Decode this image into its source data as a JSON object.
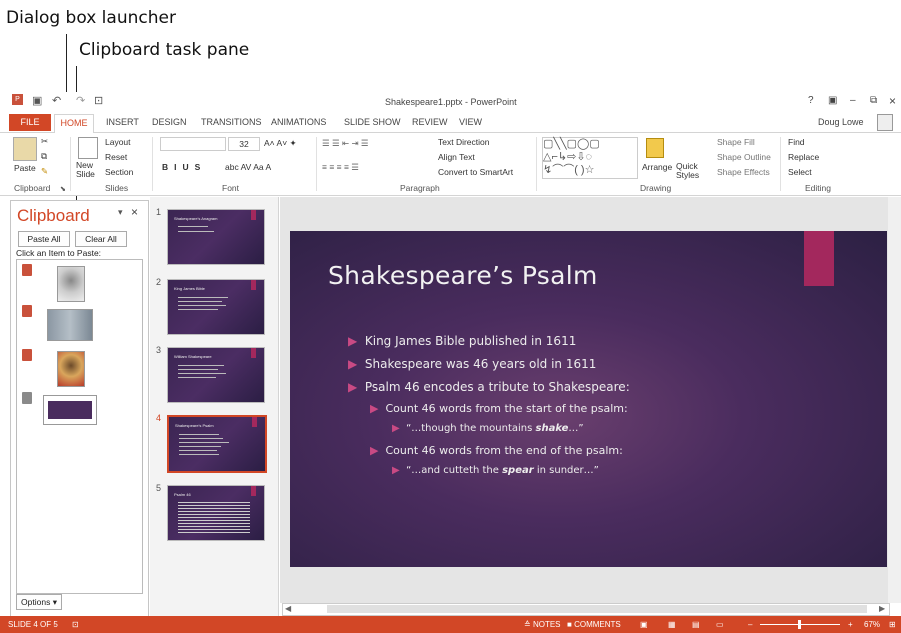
{
  "callouts": {
    "dialog_launcher": "Dialog box launcher",
    "clipboard_pane": "Clipboard task pane"
  },
  "window": {
    "title": "Shakespeare1.pptx - PowerPoint",
    "user": "Doug Lowe",
    "controls": [
      "?",
      "▣",
      "–",
      "⧉",
      "×"
    ]
  },
  "tabs": [
    "FILE",
    "HOME",
    "INSERT",
    "DESIGN",
    "TRANSITIONS",
    "ANIMATIONS",
    "SLIDE SHOW",
    "REVIEW",
    "VIEW"
  ],
  "ribbon": {
    "clipboard": {
      "label": "Clipboard",
      "paste": "Paste"
    },
    "slides": {
      "label": "Slides",
      "new_slide": "New Slide",
      "layout": "Layout",
      "reset": "Reset",
      "section": "Section"
    },
    "font": {
      "label": "Font",
      "size": "32"
    },
    "paragraph": {
      "label": "Paragraph",
      "text_direction": "Text Direction",
      "align_text": "Align Text",
      "convert": "Convert to SmartArt"
    },
    "drawing": {
      "label": "Drawing",
      "arrange": "Arrange",
      "quick_styles": "Quick Styles",
      "fill": "Shape Fill",
      "outline": "Shape Outline",
      "effects": "Shape Effects"
    },
    "editing": {
      "label": "Editing",
      "find": "Find",
      "replace": "Replace",
      "select": "Select"
    }
  },
  "clipboard_pane": {
    "title": "Clipboard",
    "paste_all": "Paste All",
    "clear_all": "Clear All",
    "instruction": "Click an Item to Paste:",
    "options": "Options"
  },
  "thumbnails": [
    {
      "num": "1",
      "title": "Shakespeare's Anagram"
    },
    {
      "num": "2",
      "title": "King James Bible"
    },
    {
      "num": "3",
      "title": "William Shakespeare"
    },
    {
      "num": "4",
      "title": "Shakespeare's Psalm"
    },
    {
      "num": "5",
      "title": "Psalm 46"
    }
  ],
  "slide": {
    "title": "Shakespeare’s Psalm",
    "bullets": [
      "King James Bible published in 1611",
      "Shakespeare was 46 years old in 1611",
      "Psalm 46 encodes a tribute to Shakespeare:"
    ],
    "sub1": "Count 46 words from the start of the psalm:",
    "sub1_quote_pre": "“…though the mountains ",
    "sub1_quote_em": "shake",
    "sub1_quote_post": "…”",
    "sub2": "Count 46 words from the end of the psalm:",
    "sub2_quote_pre": "“…and cutteth the ",
    "sub2_quote_em": "spear",
    "sub2_quote_post": " in sunder…”"
  },
  "status": {
    "slide_indicator": "SLIDE 4 OF 5",
    "notes": "NOTES",
    "comments": "COMMENTS",
    "zoom": "67%"
  }
}
